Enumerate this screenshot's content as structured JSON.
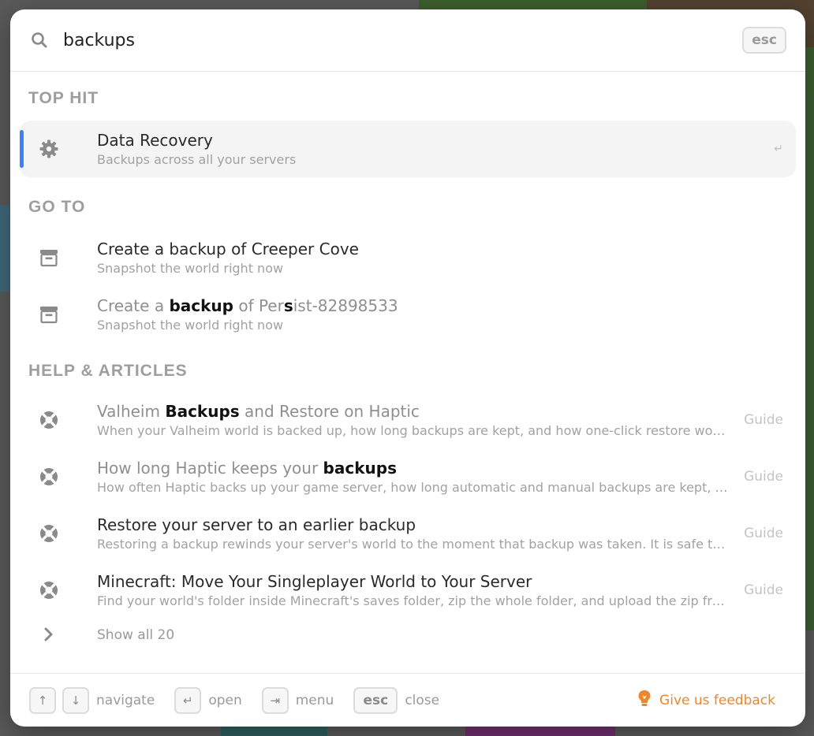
{
  "search": {
    "query": "backups",
    "esc_label": "esc"
  },
  "sections": {
    "top_hit": "TOP HIT",
    "go_to": "GO TO",
    "help": "HELP & ARTICLES"
  },
  "top_hit": {
    "title": "Data Recovery",
    "subtitle": "Backups across all your servers",
    "enter_symbol": "↵"
  },
  "goto_items": [
    {
      "title": "Create a backup of Creeper Cove",
      "subtitle": "Snapshot the world right now"
    },
    {
      "title_pre": "Create a ",
      "title_bold": "backup",
      "title_mid": " of Per",
      "title_bold2": "s",
      "title_post": "ist-82898533",
      "subtitle": "Snapshot the world right now"
    }
  ],
  "articles": [
    {
      "title_pre": "Valheim ",
      "title_bold": "Backups",
      "title_post": " and Restore on Haptic",
      "subtitle": "When your Valheim world is backed up, how long backups are kept, and how one-click restore works, and what happens after",
      "tag": "Guide"
    },
    {
      "title_pre": "How long Haptic keeps your ",
      "title_bold": "backups",
      "title_post": "",
      "subtitle": "How often Haptic backs up your game server, how long automatic and manual backups are kept, and how to download them",
      "tag": "Guide"
    },
    {
      "title": "Restore your server to an earlier backup",
      "subtitle": "Restoring a backup rewinds your server's world to the moment that backup was taken. It is safe to try and revert",
      "tag": "Guide"
    },
    {
      "title": "Minecraft: Move Your Singleplayer World to Your Server",
      "subtitle": "Find your world's folder inside Minecraft's saves folder, zip the whole folder, and upload the zip from your panel",
      "tag": "Guide"
    }
  ],
  "show_all": "Show all 20",
  "footer": {
    "up_key": "↑",
    "down_key": "↓",
    "navigate": "navigate",
    "open_key": "↵",
    "open": "open",
    "menu_key": "⇥",
    "menu": "menu",
    "esc_key": "esc",
    "close": "close",
    "feedback": "Give us feedback"
  },
  "colors": {
    "accent": "#3b82f6",
    "feedback": "#f0852a"
  }
}
